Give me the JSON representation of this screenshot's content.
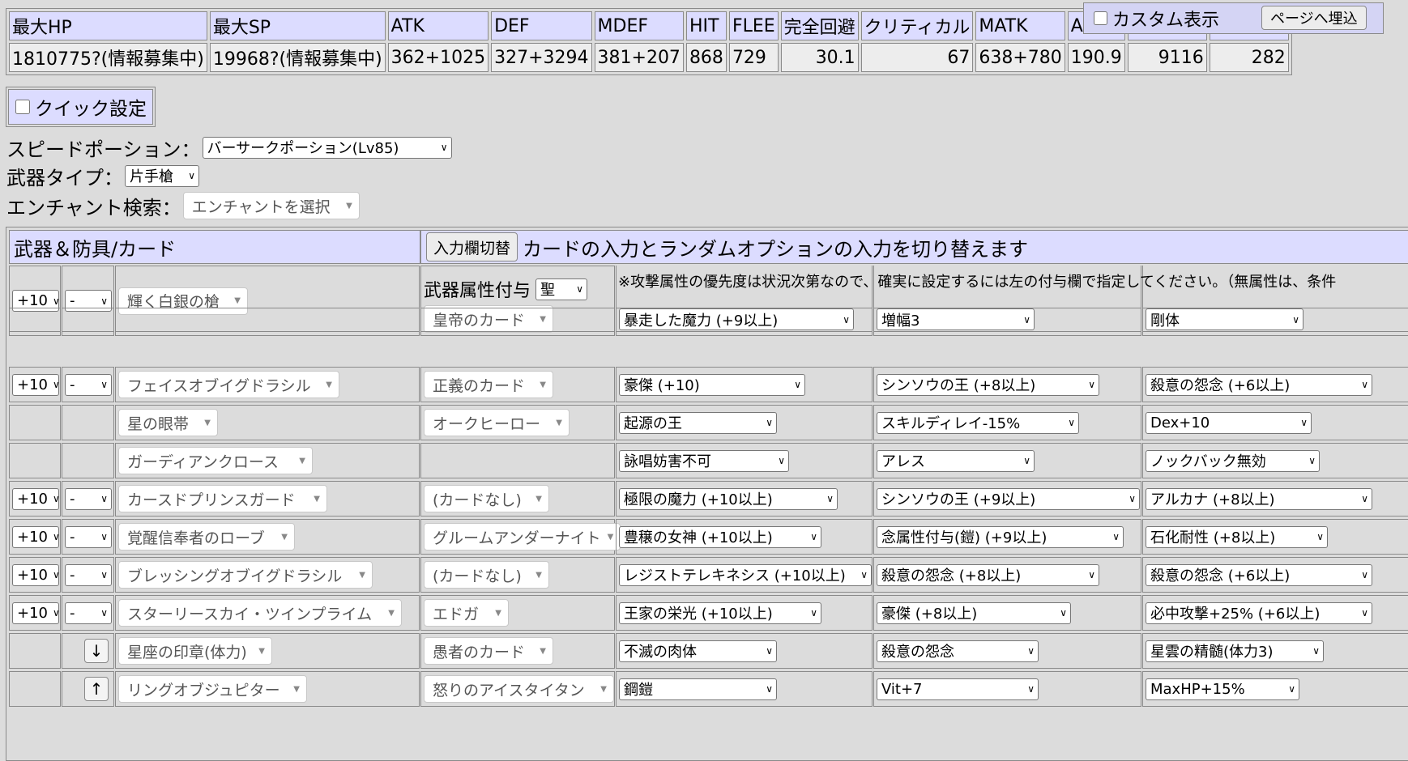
{
  "stats": {
    "headers": [
      "最大HP",
      "最大SP",
      "ATK",
      "DEF",
      "MDEF",
      "HIT",
      "FLEE",
      "完全回避",
      "クリティカル",
      "MATK",
      "ASPD",
      "",
      ""
    ],
    "values": [
      "1810775?(情報募集中)",
      "19968?(情報募集中)",
      "362+1025",
      "327+3294",
      "381+207",
      "868",
      "729",
      "30.1",
      "67",
      "638+780",
      "190.9",
      "9116",
      "282"
    ]
  },
  "custom_display": {
    "label": "カスタム表示",
    "checked": false,
    "embed_button": "ページへ埋込"
  },
  "quick_settings": {
    "label": "クイック設定",
    "checked": false
  },
  "speed_potion": {
    "label": "スピードポーション：",
    "value": "バーサークポーション(Lv85)"
  },
  "weapon_type": {
    "label": "武器タイプ：",
    "value": "片手槍"
  },
  "enchant_search": {
    "label": "エンチャント検索：",
    "placeholder": "エンチャントを選択"
  },
  "equipment": {
    "header_title": "武器＆防具/カード",
    "toggle_button": "入力欄切替",
    "toggle_desc": "カードの入力とランダムオプションの入力を切り替えます",
    "weapon_element_label": "武器属性付与",
    "weapon_element_value": "聖",
    "element_note": "※攻撃属性の優先度は状況次第なので、確実に設定するには左の付与欄で指定してください。（無属性は、条件",
    "rows": [
      {
        "refine": "+10",
        "grade": "-",
        "item": "輝く白銀の槍",
        "card": "皇帝のカード",
        "opt1": "暴走した魔力 (+9以上)",
        "opt2": "増幅3",
        "opt3": "剛体"
      },
      {
        "refine": "+10",
        "grade": "-",
        "item": "フェイスオブイグドラシル",
        "card": "正義のカード",
        "opt1": "豪傑 (+10)",
        "opt2": "シンソウの王 (+8以上)",
        "opt3": "殺意の怨念 (+6以上)"
      },
      {
        "refine": "",
        "grade": "",
        "item": "星の眼帯",
        "card": "オークヒーロー",
        "opt1": "起源の王",
        "opt2": "スキルディレイ-15%",
        "opt3": "Dex+10"
      },
      {
        "refine": "",
        "grade": "",
        "item": "ガーディアンクロース",
        "card": "",
        "opt1": "詠唱妨害不可",
        "opt2": "アレス",
        "opt3": "ノックバック無効"
      },
      {
        "refine": "+10",
        "grade": "-",
        "item": "カースドプリンスガード",
        "card": "(カードなし)",
        "opt1": "極限の魔力 (+10以上)",
        "opt2": "シンソウの王 (+9以上)",
        "opt3": "アルカナ (+8以上)"
      },
      {
        "refine": "+10",
        "grade": "-",
        "item": "覚醒信奉者のローブ",
        "card": "グルームアンダーナイト",
        "opt1": "豊穣の女神 (+10以上)",
        "opt2": "念属性付与(鎧) (+9以上)",
        "opt3": "石化耐性 (+8以上)"
      },
      {
        "refine": "+10",
        "grade": "-",
        "item": "ブレッシングオブイグドラシル",
        "card": "(カードなし)",
        "opt1": "レジストテレキネシス (+10以上)",
        "opt2": "殺意の怨念 (+8以上)",
        "opt3": "殺意の怨念 (+6以上)"
      },
      {
        "refine": "+10",
        "grade": "-",
        "item": "スターリースカイ・ツインプライム",
        "card": "エドガ",
        "opt1": "王家の栄光 (+10以上)",
        "opt2": "豪傑 (+8以上)",
        "opt3": "必中攻撃+25% (+6以上)"
      },
      {
        "refine": "",
        "grade": "↓",
        "item": "星座の印章(体力)",
        "card": "愚者のカード",
        "opt1": "不滅の肉体",
        "opt2": "殺意の怨念",
        "opt3": "星雲の精髄(体力3)"
      },
      {
        "refine": "",
        "grade": "↑",
        "item": "リングオブジュピター",
        "card": "怒りのアイスタイタン",
        "opt1": "鋼鎧",
        "opt2": "Vit+7",
        "opt3": "MaxHP+15%"
      }
    ]
  }
}
